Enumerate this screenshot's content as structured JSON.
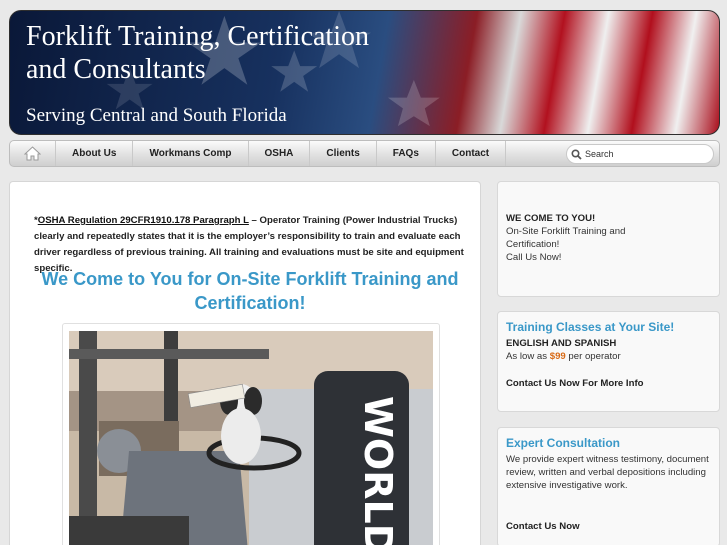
{
  "header": {
    "title_line1": "Forklift Training, Certification",
    "title_line2": "and Consultants",
    "tagline": "Serving Central and South Florida"
  },
  "nav": {
    "items": [
      "About Us",
      "Workmans Comp",
      "OSHA",
      "Clients",
      "FAQs",
      "Contact"
    ],
    "search_placeholder": "Search"
  },
  "main": {
    "intro_link": "OSHA Regulation 29CFR1910.178 Paragraph L",
    "intro_prefix": "*",
    "intro_text": " – Operator Training (Power Industrial Trucks) clearly and repeatedly states that it is the employer’s responsibility to train and evaluate each driver regardless of previous training.  All training and evaluations must be site and equipment specific.",
    "heading": "We Come to You for On-Site Forklift Training and Certification!",
    "photo_text": "WORLD"
  },
  "sidebar": {
    "box1": {
      "title": "WE COME TO YOU!",
      "line1": "On-Site Forklift Training and",
      "line2": "Certification!",
      "line3": "Call Us Now!"
    },
    "box2": {
      "title": "Training Classes at Your Site!",
      "languages": "ENGLISH AND SPANISH",
      "price_prefix": "As low as ",
      "price": "$99",
      "price_suffix": " per operator",
      "cta": "Contact Us Now For More Info"
    },
    "box3": {
      "title": "Expert Consultation",
      "text": "We provide expert witness testimony, document review, written and verbal depositions including extensive investigative work.",
      "cta": "Contact Us Now"
    }
  },
  "colors": {
    "accent": "#3a98c8",
    "price": "#d86a16"
  }
}
